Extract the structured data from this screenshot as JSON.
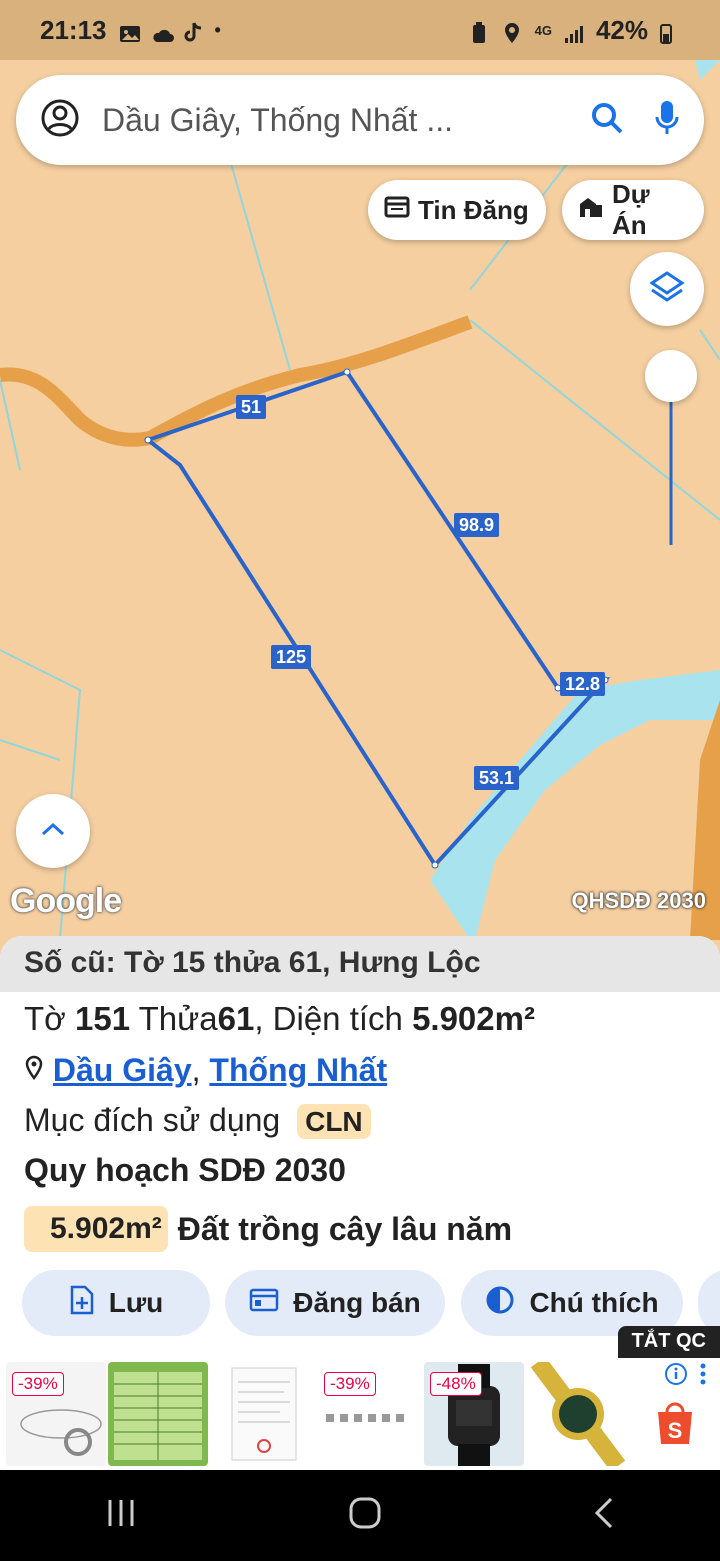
{
  "status_bar": {
    "time": "21:13",
    "signal_text": "4G",
    "battery": "42%"
  },
  "search": {
    "text": "Dầu Giây, Thống Nhất ..."
  },
  "chips": [
    {
      "label": "Tin Đăng"
    },
    {
      "label": "Dự Án"
    }
  ],
  "edge_labels": [
    "51",
    "98.9",
    "125",
    "12.8",
    "53.1"
  ],
  "map": {
    "brand": "Google",
    "layer_label": "QHSDĐ 2030"
  },
  "panel": {
    "header": "Số cũ: Tờ 15 thửa 61, Hưng Lộc",
    "parcel_line": {
      "to_label": "Tờ",
      "to_value": "151",
      "thua_label": "Thửa",
      "thua_value": "61",
      "area_label": "Diện tích",
      "area_value": "5.902m²"
    },
    "location": {
      "district": "Dầu Giây",
      "separator": ",",
      "province": "Thống Nhất"
    },
    "purpose": {
      "label": "Mục đích sử dụng",
      "code": "CLN"
    },
    "plan_title": "Quy hoạch SDĐ 2030",
    "plan_area": "5.902m²",
    "plan_desc": "Đất trồng cây lâu năm",
    "actions": [
      {
        "label": "Lưu"
      },
      {
        "label": "Đăng bán"
      },
      {
        "label": "Chú thích"
      }
    ]
  },
  "ad": {
    "close_label": "TẮT QC",
    "discounts": [
      "-39%",
      "-39%",
      "-48%"
    ]
  },
  "colors": {
    "parcel_line": "#2a63c9",
    "land": "#f5cfa0",
    "water": "#a9e3ee",
    "accent": "#1a5fd1"
  }
}
